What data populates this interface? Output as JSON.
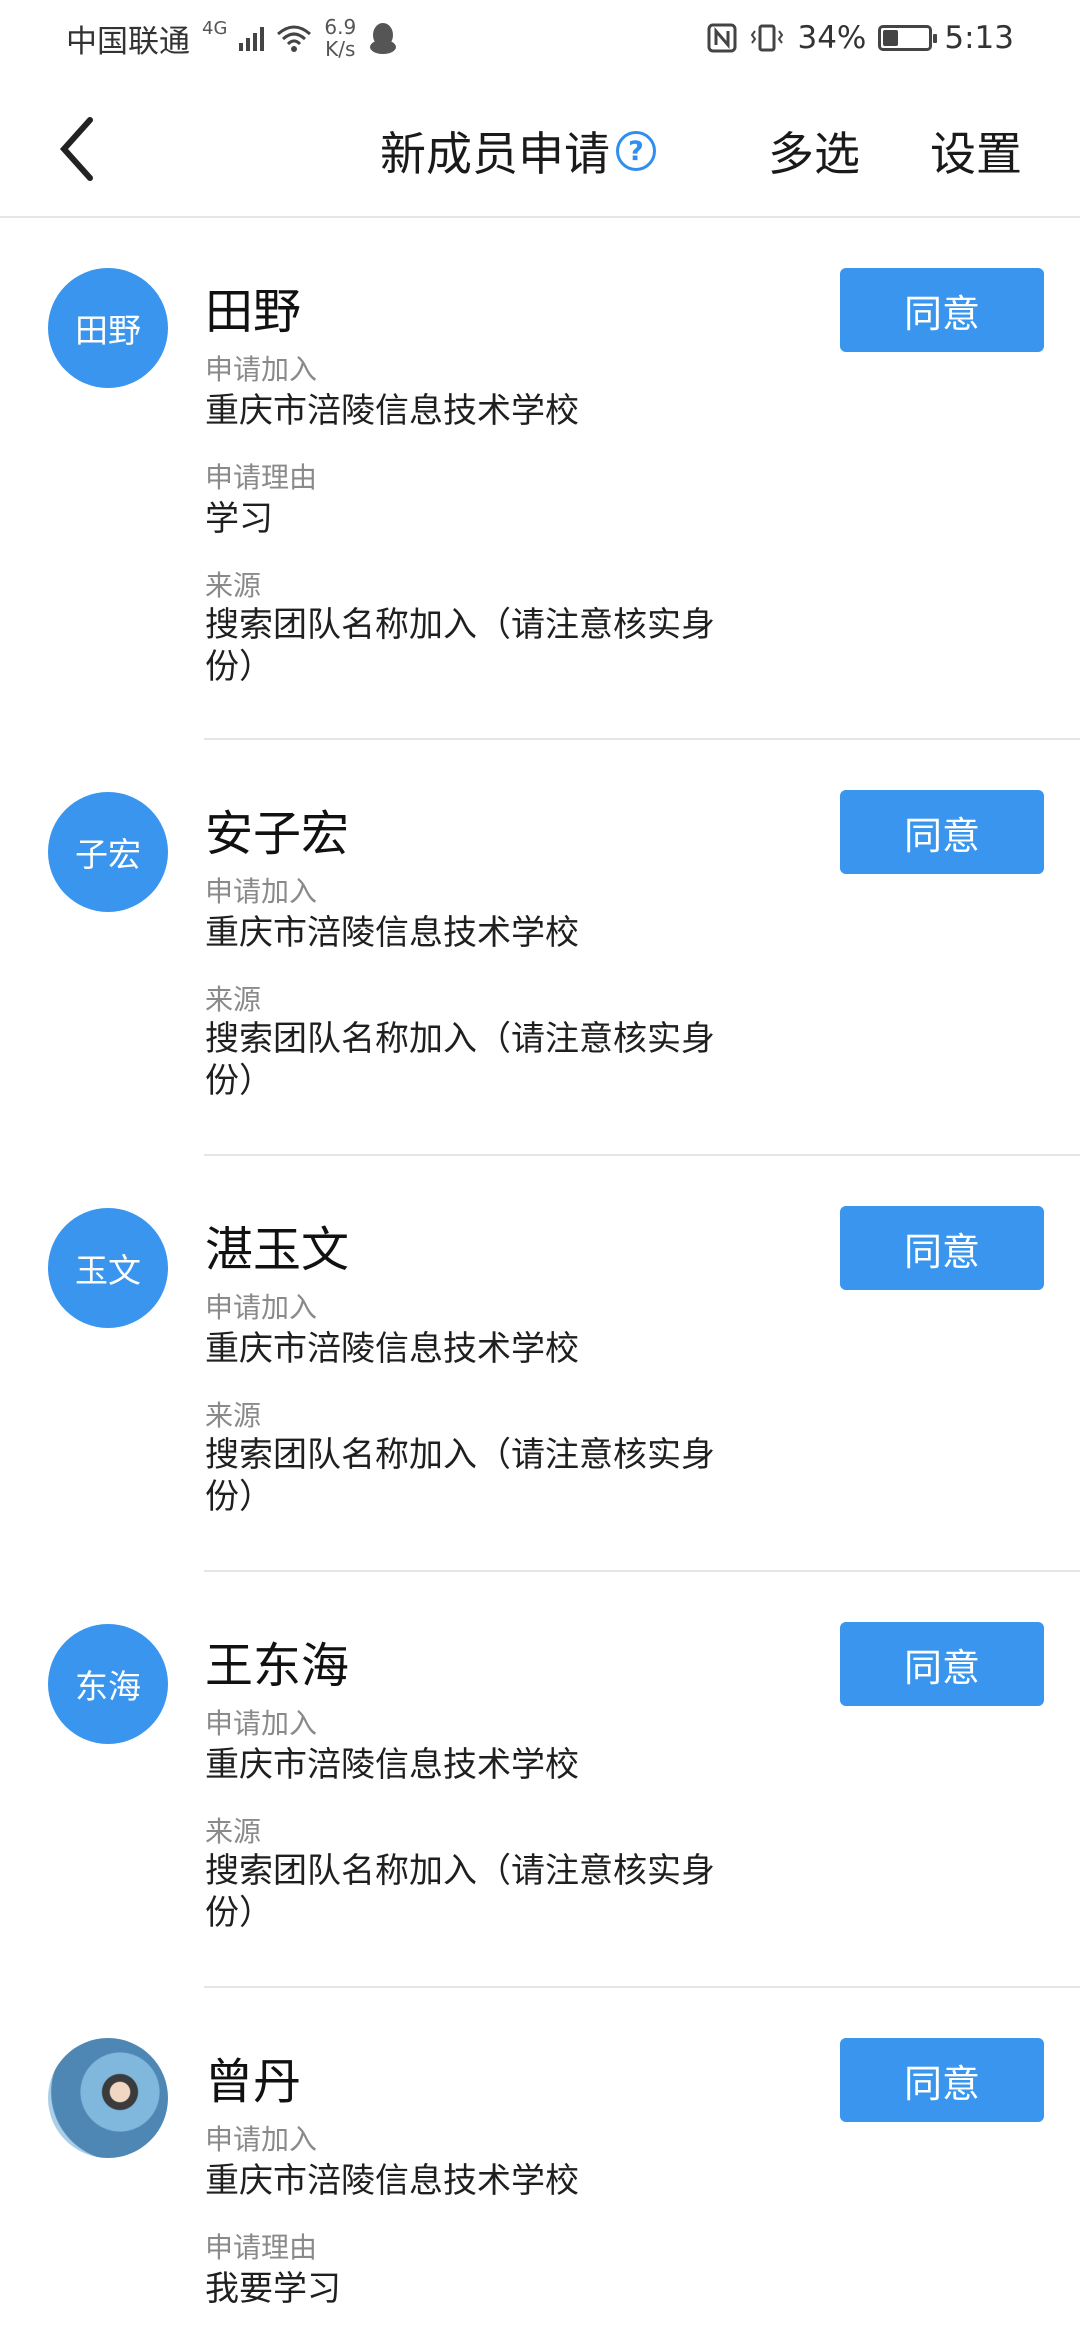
{
  "status_bar": {
    "carrier": "中国联通",
    "network": "4G",
    "speed_value": "6.9",
    "speed_unit": "K/s",
    "battery_percent": "34%",
    "battery_level": 0.34,
    "time": "5:13"
  },
  "nav": {
    "title": "新成员申请",
    "help_symbol": "?",
    "multi_select_label": "多选",
    "settings_label": "设置"
  },
  "labels": {
    "join": "申请加入",
    "reason": "申请理由",
    "source": "来源",
    "agree": "同意"
  },
  "requests": [
    {
      "avatar_text": "田野",
      "name": "田野",
      "join_target": "重庆市涪陵信息技术学校",
      "reason": "学习",
      "source_line1": "搜索团队名称加入（请注意核实身",
      "source_line2": "份）"
    },
    {
      "avatar_text": "子宏",
      "name": "安子宏",
      "join_target": "重庆市涪陵信息技术学校",
      "source_line1": "搜索团队名称加入（请注意核实身",
      "source_line2": "份）"
    },
    {
      "avatar_text": "玉文",
      "name": "湛玉文",
      "join_target": "重庆市涪陵信息技术学校",
      "source_line1": "搜索团队名称加入（请注意核实身",
      "source_line2": "份）"
    },
    {
      "avatar_text": "东海",
      "name": "王东海",
      "join_target": "重庆市涪陵信息技术学校",
      "source_line1": "搜索团队名称加入（请注意核实身",
      "source_line2": "份）"
    },
    {
      "avatar_icon": "profile-photo",
      "name": "曾丹",
      "join_target": "重庆市涪陵信息技术学校",
      "reason": "我要学习"
    }
  ],
  "colors": {
    "accent": "#3995ee",
    "help_icon": "#2f8ff0",
    "label_gray": "#8a8a8a",
    "divider": "#e6e6e6"
  }
}
